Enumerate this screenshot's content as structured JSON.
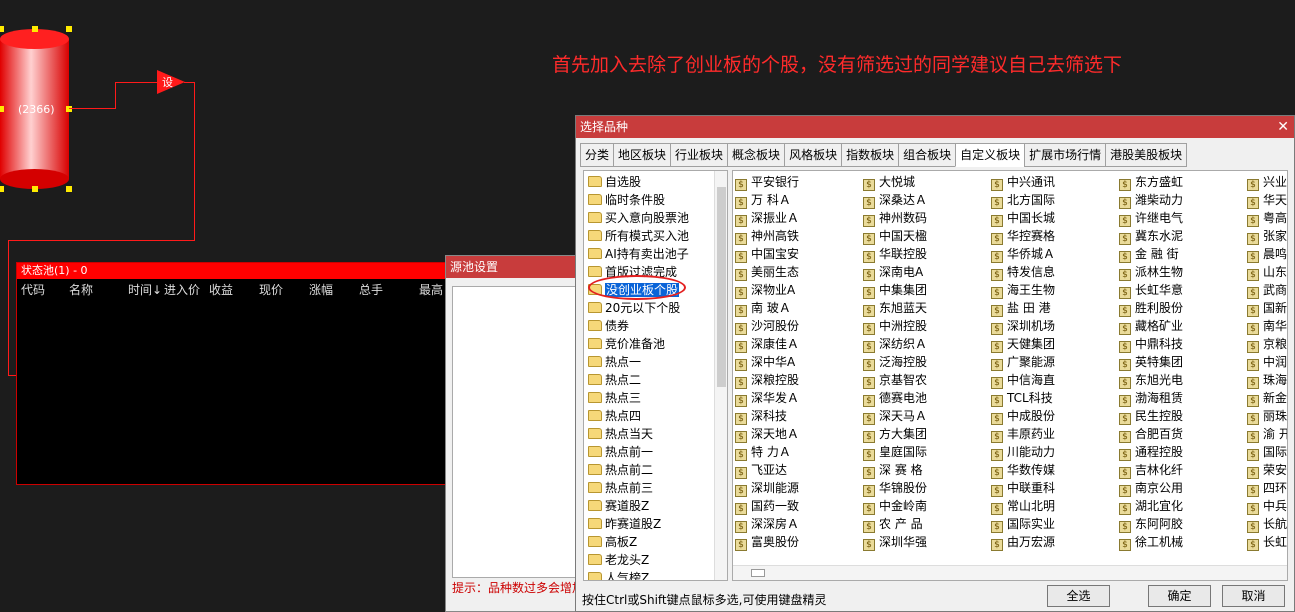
{
  "canvas": {
    "node_count": "(2366)",
    "condition_label": "设",
    "annotation": "首先加入去除了创业板的个股，没有筛选过的同学建议自己去筛选下"
  },
  "status_pool": {
    "title": "状态池(1) - 0",
    "columns": [
      "代码",
      "名称",
      "时间↓",
      "进入价",
      "收益",
      "现价",
      "涨幅",
      "总手",
      "最高"
    ]
  },
  "source_dialog": {
    "title": "源池设置",
    "hint": "提示：品种数过多会增加"
  },
  "dialog": {
    "title": "选择品种",
    "close": "✕",
    "tabs": [
      "分类",
      "地区板块",
      "行业板块",
      "概念板块",
      "风格板块",
      "指数板块",
      "组合板块",
      "自定义板块",
      "扩展市场行情",
      "港股美股板块"
    ],
    "active_tab": "自定义板块",
    "folders": [
      "自选股",
      "临时条件股",
      "买入意向股票池",
      "所有模式买入池",
      "AI持有卖出池子",
      "首版过滤完成",
      "没创业板个股",
      "20元以下个股",
      "债券",
      "竞价准备池",
      "热点一",
      "热点二",
      "热点三",
      "热点四",
      "热点当天",
      "热点前一",
      "热点前二",
      "热点前三",
      "赛道股Z",
      "昨赛道股Z",
      "高板Z",
      "老龙头Z",
      "人气榜Z"
    ],
    "selected_folder": "没创业板个股",
    "stock_columns": [
      [
        "平安银行",
        "万 科Ａ",
        "深振业Ａ",
        "神州高铁",
        "中国宝安",
        "美丽生态",
        "深物业A",
        "南 玻Ａ",
        "沙河股份",
        "深康佳Ａ",
        "深中华A",
        "深粮控股",
        "深华发Ａ",
        "深科技",
        "深天地Ａ",
        "特 力Ａ",
        "飞亚达",
        "深圳能源",
        "国药一致",
        "深深房Ａ",
        "富奥股份"
      ],
      [
        "大悦城",
        "深桑达Ａ",
        "神州数码",
        "中国天楹",
        "华联控股",
        "深南电A",
        "中集集团",
        "东旭蓝天",
        "中洲控股",
        "深纺织Ａ",
        "泛海控股",
        "京基智农",
        "德赛电池",
        "深天马Ａ",
        "方大集团",
        "皇庭国际",
        "深 赛 格",
        "华锦股份",
        "中金岭南",
        "农 产 品",
        "深圳华强"
      ],
      [
        "中兴通讯",
        "北方国际",
        "中国长城",
        "华控赛格",
        "华侨城Ａ",
        "特发信息",
        "海王生物",
        "盐 田 港",
        "深圳机场",
        "天健集团",
        "广聚能源",
        "中信海直",
        "TCL科技",
        "中成股份",
        "丰原药业",
        "川能动力",
        "华数传媒",
        "中联重科",
        "常山北明",
        "国际实业",
        "由万宏源"
      ],
      [
        "东方盛虹",
        "潍柴动力",
        "许继电气",
        "冀东水泥",
        "金 融 街",
        "派林生物",
        "长虹华意",
        "胜利股份",
        "藏格矿业",
        "中鼎科技",
        "英特集团",
        "东旭光电",
        "渤海租赁",
        "民生控股",
        "合肥百货",
        "通程控股",
        "吉林化纤",
        "南京公用",
        "湖北宜化",
        "东阿阿胶",
        "徐工机械"
      ],
      [
        "兴业",
        "华天",
        "粤高",
        "张家",
        "晨鸣",
        "山东",
        "武商",
        "国新",
        "南华",
        "京粮",
        "中润",
        "珠海",
        "新金",
        "丽珠",
        "渝 开",
        "国际",
        "荣安",
        "四环",
        "中兵",
        "长航",
        "长虹"
      ]
    ],
    "footer_hint": "按住Ctrl或Shift键点鼠标多选,可使用键盘精灵",
    "buttons": {
      "select_all": "全选",
      "ok": "确定",
      "cancel": "取消"
    }
  },
  "colors": {
    "title_bar": "#c83c3c",
    "pool_title": "#ff0000",
    "annotation": "#ff2b2b",
    "selection": "#0a64d8"
  }
}
